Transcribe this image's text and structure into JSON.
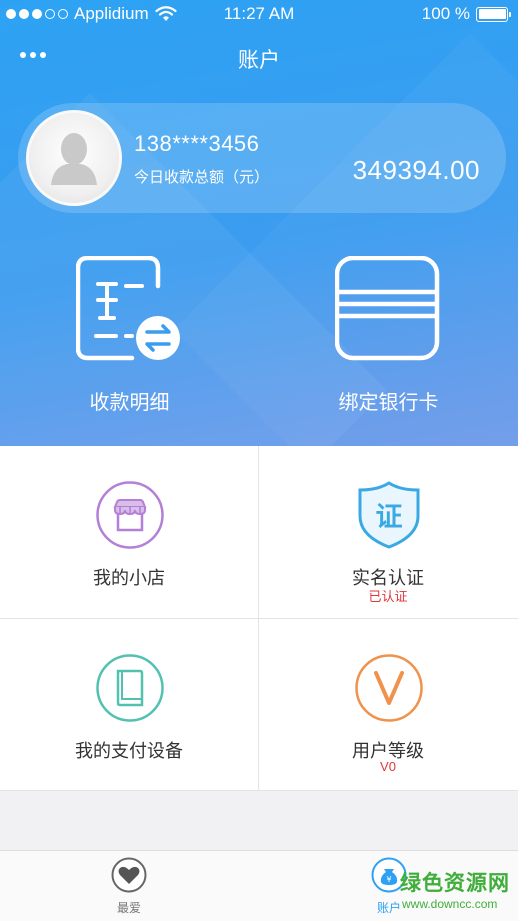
{
  "status_bar": {
    "carrier": "Applidium",
    "time": "11:27 AM",
    "battery": "100 %",
    "signal_level": 3
  },
  "nav": {
    "title": "账户",
    "more_icon": "more-dots-icon"
  },
  "account": {
    "phone": "138****3456",
    "today_label": "今日收款总额（元）",
    "today_amount": "349394.00"
  },
  "quick_actions": [
    {
      "label": "收款明细",
      "icon": "receipt-exchange-icon"
    },
    {
      "label": "绑定银行卡",
      "icon": "bank-card-icon"
    }
  ],
  "menu": [
    {
      "label": "我的小店",
      "icon": "shop-icon",
      "color": "#b47fd6",
      "sub": ""
    },
    {
      "label": "实名认证",
      "icon": "certificate-shield-icon",
      "color": "#3aa9e3",
      "sub": "已认证"
    },
    {
      "label": "我的支付设备",
      "icon": "device-icon",
      "color": "#53c1b0",
      "sub": ""
    },
    {
      "label": "用户等级",
      "icon": "vip-level-icon",
      "color": "#f0914c",
      "sub": "V0"
    }
  ],
  "tabs": [
    {
      "label": "最爱",
      "icon": "heart-icon"
    },
    {
      "label": "账户",
      "icon": "account-bag-icon"
    }
  ],
  "watermark": {
    "title": "绿色资源网",
    "url": "www.downcc.com"
  },
  "colors": {
    "accent": "#2ea1f2",
    "verified_red": "#e0363a"
  }
}
